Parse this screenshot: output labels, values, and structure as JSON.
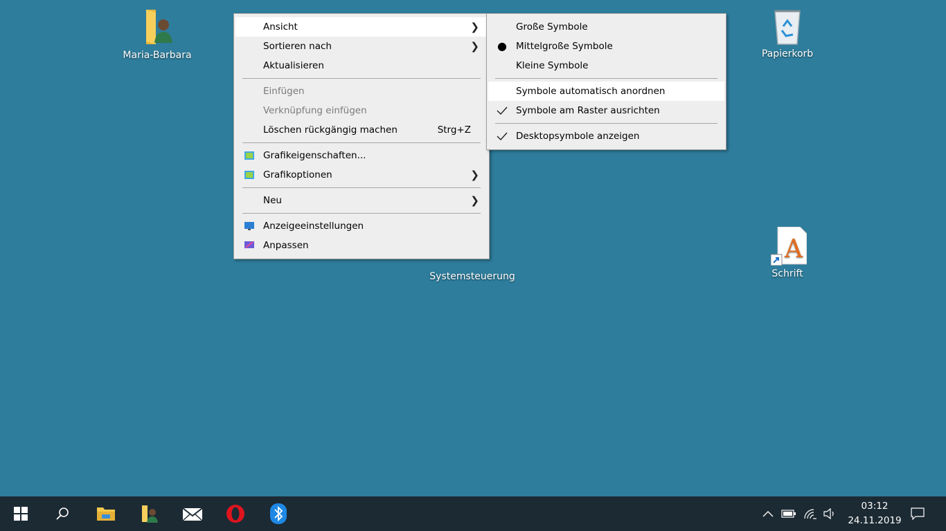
{
  "desktop": {
    "icons": [
      {
        "label": "Maria-Barbara",
        "icon": "user-folder-icon"
      },
      {
        "label": "Papierkorb",
        "icon": "recycle-bin-icon"
      },
      {
        "label": "Systemsteuerung",
        "icon": "control-panel-icon"
      },
      {
        "label": "Schrift",
        "icon": "font-shortcut-icon"
      }
    ],
    "background_color": "#2e7d9c"
  },
  "context_menu": {
    "items": [
      {
        "label": "Ansicht",
        "submenu": true
      },
      {
        "label": "Sortieren nach",
        "submenu": true
      },
      {
        "label": "Aktualisieren"
      },
      {
        "label": "Einfügen",
        "disabled": true
      },
      {
        "label": "Verknüpfung einfügen",
        "disabled": true
      },
      {
        "label": "Löschen rückgängig machen",
        "shortcut": "Strg+Z"
      },
      {
        "label": "Grafikeigenschaften...",
        "icon": "graphics-icon"
      },
      {
        "label": "Grafikoptionen",
        "icon": "graphics-icon",
        "submenu": true
      },
      {
        "label": "Neu",
        "submenu": true
      },
      {
        "label": "Anzeigeeinstellungen",
        "icon": "display-settings-icon"
      },
      {
        "label": "Anpassen",
        "icon": "personalize-icon"
      }
    ]
  },
  "view_submenu": {
    "items": [
      {
        "label": "Große Symbole"
      },
      {
        "label": "Mittelgroße Symbole",
        "selected": true
      },
      {
        "label": "Kleine Symbole"
      },
      {
        "label": "Symbole automatisch anordnen"
      },
      {
        "label": "Symbole am Raster ausrichten",
        "checked": true
      },
      {
        "label": "Desktopsymbole anzeigen",
        "checked": true
      }
    ]
  },
  "taskbar": {
    "apps": [
      "start-icon",
      "search-icon",
      "file-explorer-icon",
      "user-folder-icon",
      "mail-icon",
      "opera-icon",
      "bluetooth-icon"
    ],
    "tray": [
      "chevron-up-icon",
      "battery-icon",
      "wifi-icon",
      "volume-icon",
      "notification-icon"
    ],
    "time": "03:12",
    "date": "24.11.2019",
    "background_color": "#1c2a33"
  }
}
